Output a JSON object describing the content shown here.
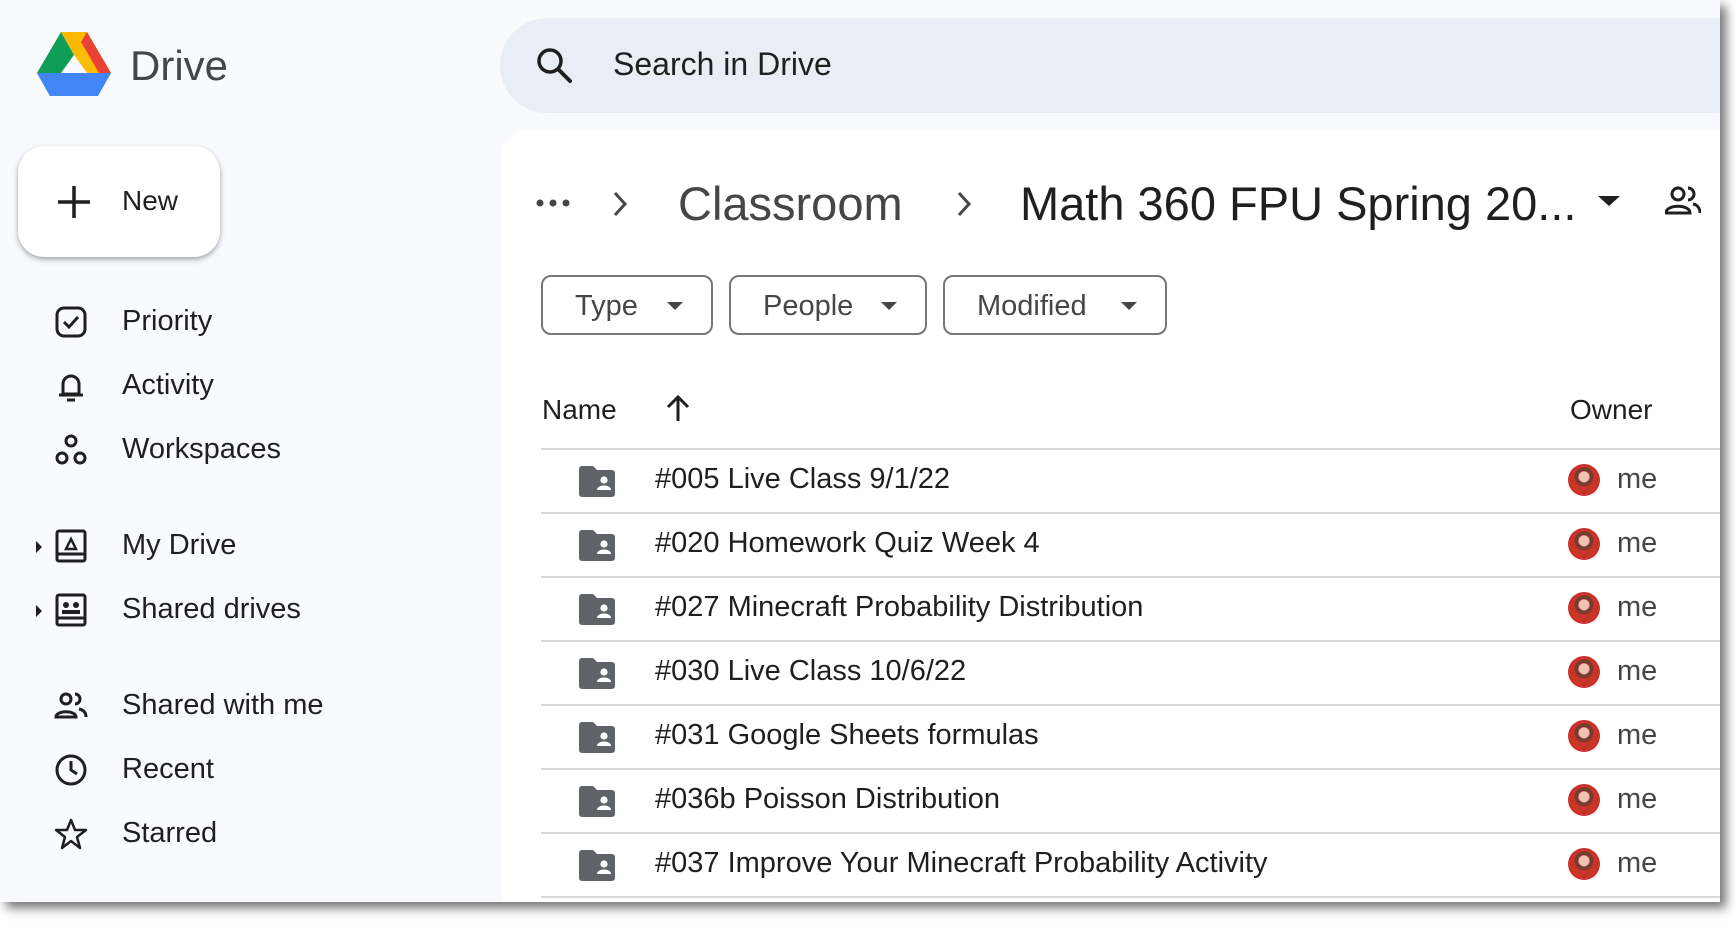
{
  "app": {
    "brand": "Drive"
  },
  "search": {
    "placeholder": "Search in Drive"
  },
  "sidebar": {
    "new_label": "New",
    "items": [
      {
        "label": "Priority",
        "icon": "priority-icon"
      },
      {
        "label": "Activity",
        "icon": "bell-icon"
      },
      {
        "label": "Workspaces",
        "icon": "workspaces-icon"
      },
      {
        "label": "My Drive",
        "icon": "my-drive-icon",
        "expandable": true
      },
      {
        "label": "Shared drives",
        "icon": "shared-drives-icon",
        "expandable": true
      },
      {
        "label": "Shared with me",
        "icon": "people-icon"
      },
      {
        "label": "Recent",
        "icon": "clock-icon"
      },
      {
        "label": "Starred",
        "icon": "star-icon"
      }
    ]
  },
  "breadcrumb": {
    "parent": "Classroom",
    "current": "Math 360 FPU Spring 20..."
  },
  "filters": [
    "Type",
    "People",
    "Modified"
  ],
  "table": {
    "columns": {
      "name": "Name",
      "owner": "Owner"
    },
    "sort": "ascending",
    "rows": [
      {
        "name": "#005 Live Class 9/1/22",
        "owner": "me"
      },
      {
        "name": "#020 Homework Quiz Week 4",
        "owner": "me"
      },
      {
        "name": "#027 Minecraft Probability Distribution",
        "owner": "me"
      },
      {
        "name": "#030 Live Class 10/6/22",
        "owner": "me"
      },
      {
        "name": "#031 Google Sheets formulas",
        "owner": "me"
      },
      {
        "name": "#036b Poisson Distribution",
        "owner": "me"
      },
      {
        "name": "#037 Improve Your Minecraft Probability Activity",
        "owner": "me"
      }
    ]
  },
  "colors": {
    "background": "#f8fafd",
    "search_bar": "#e9eef6",
    "folder": "#5f6368",
    "divider": "#d7d9dc"
  }
}
